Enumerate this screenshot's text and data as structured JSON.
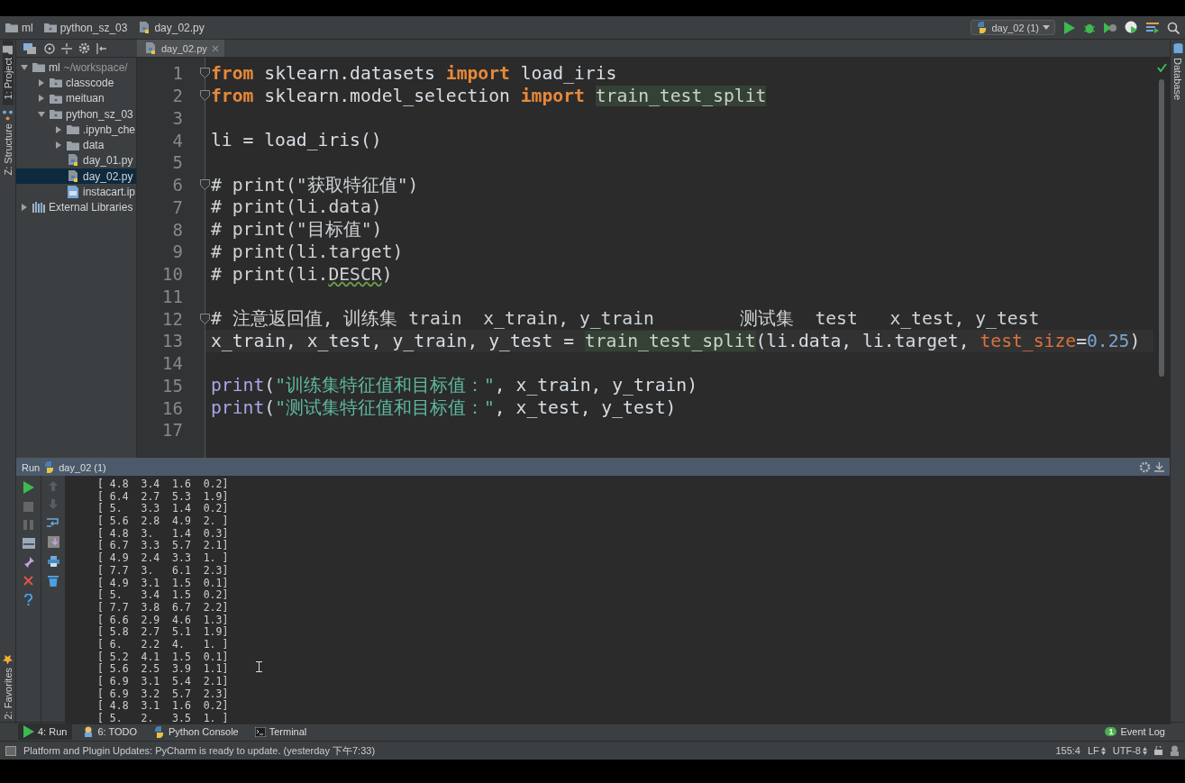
{
  "breadcrumbs": [
    {
      "label": "ml",
      "kind": "folder"
    },
    {
      "label": "python_sz_03",
      "kind": "module"
    },
    {
      "label": "day_02.py",
      "kind": "python"
    }
  ],
  "run_config": {
    "label": "day_02 (1)"
  },
  "side_tools_left": [
    {
      "label": "1: Project",
      "selected": true,
      "kind": "project"
    },
    {
      "label": "Z: Structure",
      "selected": false,
      "kind": "structure"
    }
  ],
  "side_tools_left_bottom": [
    {
      "label": "2: Favorites",
      "selected": false,
      "kind": "favorites"
    }
  ],
  "side_tools_right": [
    {
      "label": "Database",
      "kind": "database"
    }
  ],
  "editor_tabs": [
    {
      "label": "day_02.py",
      "selected": true
    }
  ],
  "project_tree": [
    {
      "label": "ml",
      "path": "~/workspace/",
      "kind": "root",
      "expanded": true,
      "selected": false,
      "children": [
        {
          "label": "classcode",
          "kind": "module",
          "expanded": false,
          "selected": false
        },
        {
          "label": "meituan",
          "kind": "module",
          "expanded": false,
          "selected": false
        },
        {
          "label": "python_sz_03",
          "kind": "module",
          "expanded": true,
          "selected": false,
          "children": [
            {
              "label": ".ipynb_che",
              "kind": "folder",
              "expanded": false,
              "selected": false
            },
            {
              "label": "data",
              "kind": "folder",
              "expanded": false,
              "selected": false
            },
            {
              "label": "day_01.py",
              "kind": "python",
              "selected": false
            },
            {
              "label": "day_02.py",
              "kind": "python",
              "selected": true
            },
            {
              "label": "instacart.ip",
              "kind": "notebook",
              "selected": false
            }
          ]
        }
      ]
    },
    {
      "label": "External Libraries",
      "kind": "library",
      "expanded": false,
      "selected": false
    }
  ],
  "code": {
    "lines": [
      {
        "number": "1",
        "fold": true,
        "current": false,
        "tokens": [
          {
            "text": "from",
            "kind": "keyword"
          },
          {
            "text": " sklearn.datasets ",
            "kind": "plain"
          },
          {
            "text": "import",
            "kind": "keyword"
          },
          {
            "text": " load_iris",
            "kind": "plain"
          }
        ]
      },
      {
        "number": "2",
        "fold": true,
        "current": false,
        "tokens": [
          {
            "text": "from",
            "kind": "keyword"
          },
          {
            "text": " sklearn.model_selection ",
            "kind": "plain"
          },
          {
            "text": "import ",
            "kind": "keyword"
          },
          {
            "text": "train_test_split",
            "kind": "usage"
          }
        ]
      },
      {
        "number": "3",
        "fold": false,
        "current": false
      },
      {
        "number": "4",
        "fold": false,
        "current": false,
        "tokens": [
          {
            "text": "li = load_iris()",
            "kind": "plain"
          }
        ]
      },
      {
        "number": "5",
        "fold": false,
        "current": false
      },
      {
        "number": "6",
        "fold": true,
        "current": false,
        "tokens": [
          {
            "text": "# print(\"获取特征值\")",
            "kind": "comment"
          }
        ]
      },
      {
        "number": "7",
        "fold": false,
        "current": false,
        "tokens": [
          {
            "text": "# print(li.data)",
            "kind": "comment"
          }
        ]
      },
      {
        "number": "8",
        "fold": false,
        "current": false,
        "tokens": [
          {
            "text": "# print(\"目标值\")",
            "kind": "comment"
          }
        ]
      },
      {
        "number": "9",
        "fold": false,
        "current": false,
        "tokens": [
          {
            "text": "# print(li.target)",
            "kind": "comment"
          }
        ]
      },
      {
        "number": "10",
        "fold": false,
        "current": false,
        "tokens": [
          {
            "text": "# print(li.",
            "kind": "comment"
          },
          {
            "text": "DESCR",
            "kind": "typo"
          },
          {
            "text": ")",
            "kind": "comment"
          }
        ]
      },
      {
        "number": "11",
        "fold": false,
        "current": false
      },
      {
        "number": "12",
        "fold": true,
        "current": false,
        "tokens": [
          {
            "text": "# 注意返回值, 训练集 train  x_train, y_train        测试集  test   x_test, y_test",
            "kind": "comment"
          }
        ]
      },
      {
        "number": "13",
        "fold": false,
        "current": true,
        "tokens": [
          {
            "text": "x_train, x_test, y_train, y_test = ",
            "kind": "plain"
          },
          {
            "text": "train_test_split",
            "kind": "usage"
          },
          {
            "text": "(li.data, li.target, ",
            "kind": "plain"
          },
          {
            "text": "test_size",
            "kind": "param"
          },
          {
            "text": "=",
            "kind": "plain"
          },
          {
            "text": "0.25",
            "kind": "number"
          },
          {
            "text": ")",
            "kind": "plain"
          }
        ]
      },
      {
        "number": "14",
        "fold": false,
        "current": false
      },
      {
        "number": "15",
        "fold": false,
        "current": false,
        "tokens": [
          {
            "text": "print",
            "kind": "builtin"
          },
          {
            "text": "(",
            "kind": "plain"
          },
          {
            "text": "\"训练集特征值和目标值：\"",
            "kind": "string"
          },
          {
            "text": ", x_train, y_train)",
            "kind": "plain"
          }
        ]
      },
      {
        "number": "16",
        "fold": false,
        "current": false,
        "tokens": [
          {
            "text": "print",
            "kind": "builtin"
          },
          {
            "text": "(",
            "kind": "plain"
          },
          {
            "text": "\"测试集特征值和目标值：\"",
            "kind": "string"
          },
          {
            "text": ", x_test, y_test)",
            "kind": "plain"
          }
        ]
      },
      {
        "number": "17",
        "fold": false,
        "current": false
      }
    ]
  },
  "run_panel": {
    "title": "Run",
    "config": "day_02 (1)",
    "output": [
      "[ 4.8  3.4  1.6  0.2]",
      "[ 6.4  2.7  5.3  1.9]",
      "[ 5.   3.3  1.4  0.2]",
      "[ 5.6  2.8  4.9  2. ]",
      "[ 4.8  3.   1.4  0.3]",
      "[ 6.7  3.3  5.7  2.1]",
      "[ 4.9  2.4  3.3  1. ]",
      "[ 7.7  3.   6.1  2.3]",
      "[ 4.9  3.1  1.5  0.1]",
      "[ 5.   3.4  1.5  0.2]",
      "[ 7.7  3.8  6.7  2.2]",
      "[ 6.6  2.9  4.6  1.3]",
      "[ 5.8  2.7  5.1  1.9]",
      "[ 6.   2.2  4.   1. ]",
      "[ 5.2  4.1  1.5  0.1]",
      "[ 5.6  2.5  3.9  1.1]",
      "[ 6.9  3.1  5.4  2.1]",
      "[ 6.9  3.2  5.7  2.3]",
      "[ 4.8  3.1  1.6  0.2]",
      "[ 5.   2.   3.5  1. ]"
    ]
  },
  "tool_tabs": [
    {
      "label": "4: Run",
      "kind": "run",
      "selected": true
    },
    {
      "label": "6: TODO",
      "kind": "todo",
      "selected": false
    },
    {
      "label": "Python Console",
      "kind": "console",
      "selected": false
    },
    {
      "label": "Terminal",
      "kind": "terminal",
      "selected": false
    }
  ],
  "event_log": {
    "label": "Event Log",
    "badge": "1"
  },
  "status_bar": {
    "message": "Platform and Plugin Updates: PyCharm is ready to update. (yesterday 下午7:33)",
    "position": "155:4",
    "line_separator": "LF",
    "encoding": "UTF-8"
  }
}
